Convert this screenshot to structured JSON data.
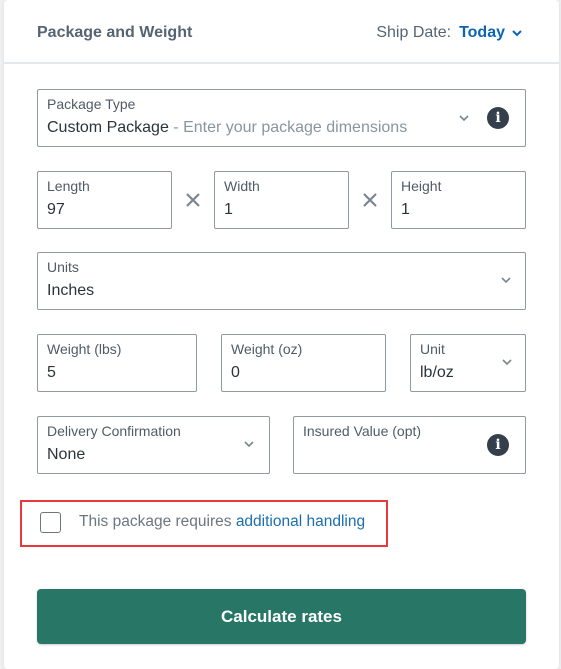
{
  "header": {
    "title": "Package and Weight",
    "ship_date_label": "Ship Date:",
    "ship_date_value": "Today"
  },
  "package_type": {
    "label": "Package Type",
    "value": "Custom Package",
    "hint": " - Enter your package dimensions"
  },
  "dimensions": {
    "length": {
      "label": "Length",
      "value": "97"
    },
    "width": {
      "label": "Width",
      "value": "1"
    },
    "height": {
      "label": "Height",
      "value": "1"
    }
  },
  "units": {
    "label": "Units",
    "value": "Inches"
  },
  "weight": {
    "lbs": {
      "label": "Weight (lbs)",
      "value": "5"
    },
    "oz": {
      "label": "Weight (oz)",
      "value": "0"
    },
    "unit": {
      "label": "Unit",
      "value": "lb/oz"
    }
  },
  "delivery_confirmation": {
    "label": "Delivery Confirmation",
    "value": "None"
  },
  "insured_value": {
    "label": "Insured Value (opt)",
    "value": ""
  },
  "handling": {
    "checked": false,
    "text": "This package requires ",
    "link": "additional handling"
  },
  "calculate_button": "Calculate rates",
  "colors": {
    "accent_blue": "#0a66b3",
    "button_green": "#287766",
    "highlight_red": "#e8383d"
  }
}
